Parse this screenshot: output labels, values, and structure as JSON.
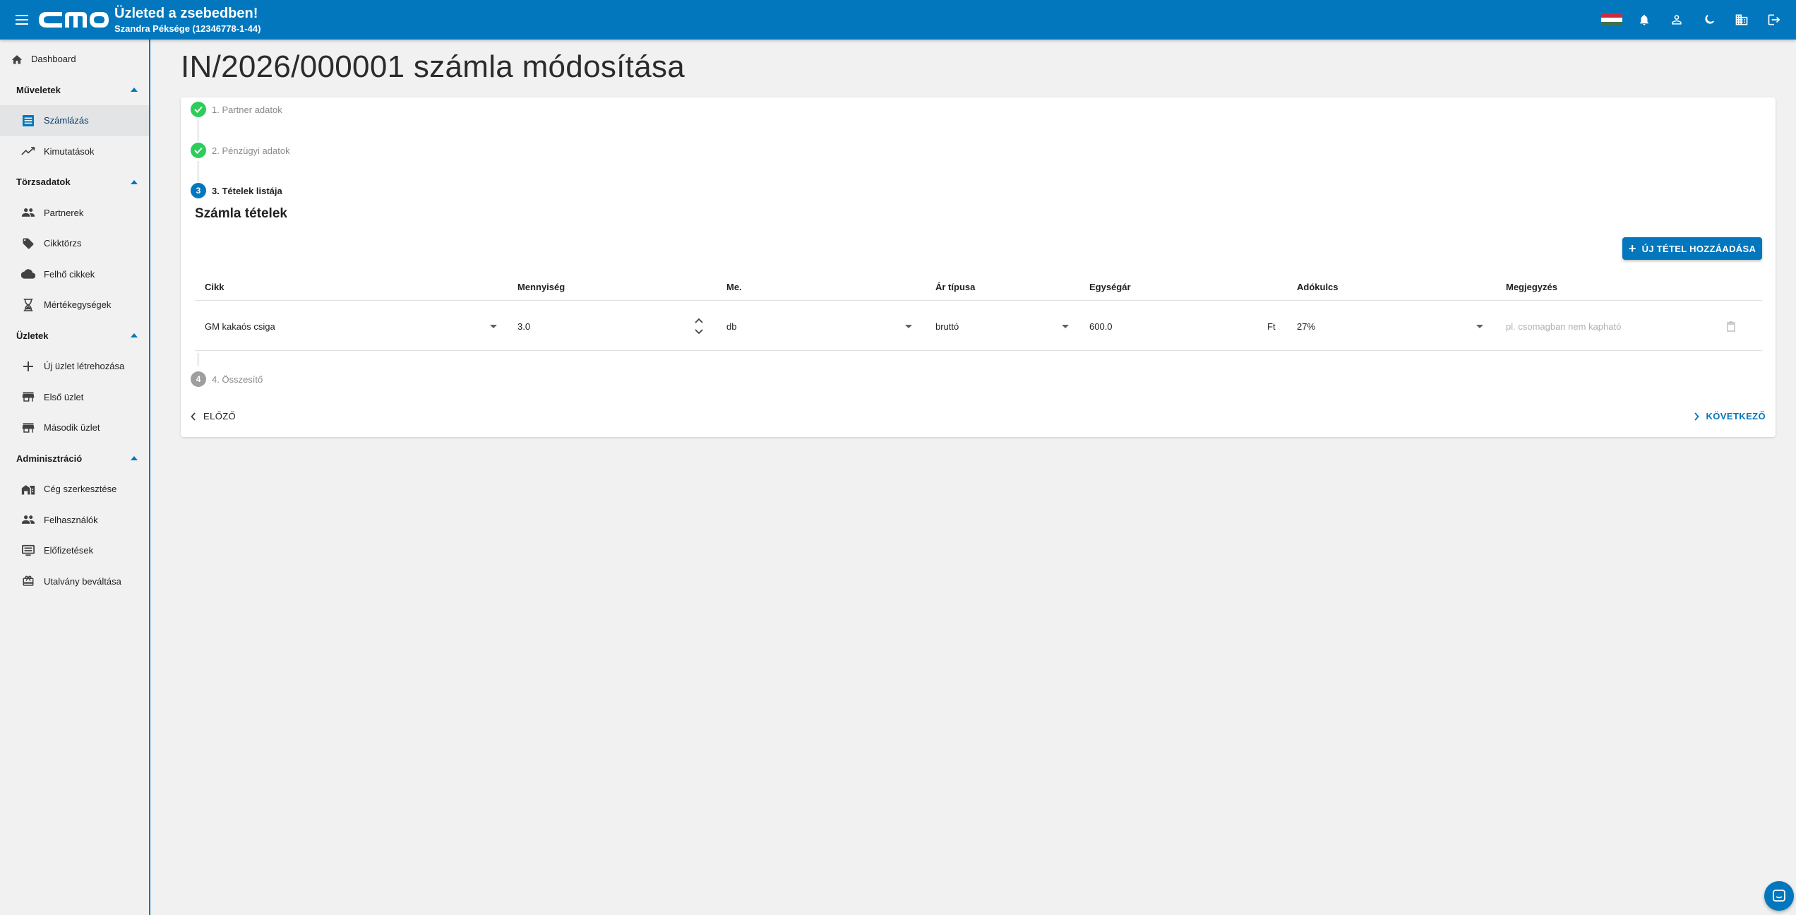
{
  "header": {
    "title": "Üzleted a zsebedben!",
    "subtitle": "Szandra Péksége (12346778-1-44)",
    "logo_text": "cmo",
    "icons": [
      "menu-icon",
      "flag-hu-icon",
      "bell-icon",
      "account-icon",
      "dark-mode-icon",
      "company-icon",
      "logout-icon"
    ]
  },
  "sidebar": {
    "dashboard": "Dashboard",
    "sections": [
      {
        "label": "Műveletek",
        "items": [
          "Számlázás",
          "Kimutatások"
        ]
      },
      {
        "label": "Törzsadatok",
        "items": [
          "Partnerek",
          "Cikktörzs",
          "Felhő cikkek",
          "Mértékegységek"
        ]
      },
      {
        "label": "Üzletek",
        "items": [
          "Új üzlet létrehozása",
          "Első üzlet",
          "Második üzlet"
        ]
      },
      {
        "label": "Adminisztráció",
        "items": [
          "Cég szerkesztése",
          "Felhasználók",
          "Előfizetések",
          "Utalvány beváltása"
        ]
      }
    ],
    "active_item": "Számlázás"
  },
  "page": {
    "title": "IN/2026/000001 számla módosítása"
  },
  "stepper": {
    "steps": [
      {
        "number": "1",
        "label": "1. Partner adatok",
        "state": "done"
      },
      {
        "number": "2",
        "label": "2. Pénzügyi adatok",
        "state": "done"
      },
      {
        "number": "3",
        "label": "3. Tételek listája",
        "state": "current"
      },
      {
        "number": "4",
        "label": "4. Összesítő",
        "state": "todo"
      }
    ]
  },
  "items_section": {
    "title": "Számla tételek",
    "add_button": "ÚJ TÉTEL HOZZÁADÁSA",
    "columns": [
      "Cikk",
      "Mennyiség",
      "Me.",
      "Ár típusa",
      "Egységár",
      "Adókulcs",
      "Megjegyzés"
    ],
    "rows": [
      {
        "cikk": "GM kakaós csiga",
        "mennyiseg": "3.0",
        "me": "db",
        "ar_tipusa": "bruttó",
        "egysegar": "600.0",
        "currency": "Ft",
        "adokulcs": "27%",
        "megjegyzes_placeholder": "pl. csomagban nem kapható"
      }
    ]
  },
  "nav": {
    "prev": "ELŐZŐ",
    "next": "KÖVETKEZŐ"
  },
  "colors": {
    "primary": "#0277bd",
    "done": "#2ecc5a",
    "background": "#f1f1f1"
  }
}
